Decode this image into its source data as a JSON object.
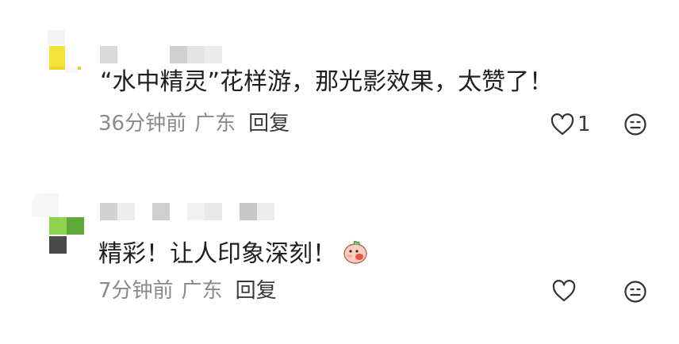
{
  "comments": [
    {
      "text": "“水中精灵”花样游，那光影效果，太赞了！",
      "time": "36分钟前",
      "location": "广东",
      "reply_label": "回复",
      "like_count": "1",
      "colors": {
        "avatar_accent": "#f2e23a"
      }
    },
    {
      "text": "精彩！让人印象深刻！",
      "emoji": "pig-face-emoji",
      "time": "7分钟前",
      "location": "广东",
      "reply_label": "回复",
      "like_count": "",
      "colors": {
        "avatar_accent": "#8ed24f"
      }
    }
  ],
  "icons": {
    "like": "heart-icon",
    "dislike": "neutral-face-icon"
  }
}
